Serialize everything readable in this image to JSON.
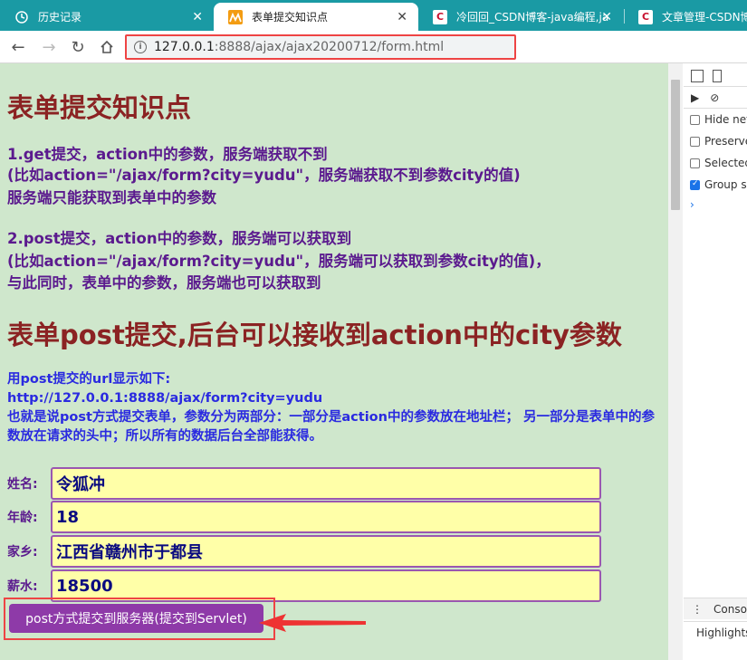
{
  "browser": {
    "tabs": [
      {
        "label": "历史记录",
        "favicon": "history-icon",
        "active": false
      },
      {
        "label": "表单提交知识点",
        "favicon": "ma-icon",
        "active": true
      },
      {
        "label": "冷回回_CSDN博客-java编程,ja",
        "favicon": "C",
        "active": false
      },
      {
        "label": "文章管理-CSDN博",
        "favicon": "C",
        "active": false
      }
    ],
    "url_host": "127.0.0.1",
    "url_rest": ":8888/ajax/ajax20200712/form.html"
  },
  "page": {
    "title": "表单提交知识点",
    "get_section": [
      "1.get提交，action中的参数，服务端获取不到",
      "(比如action=\"/ajax/form?city=yudu\"，服务端获取不到参数city的值)",
      "服务端只能获取到表单中的参数"
    ],
    "post_section": [
      "2.post提交，action中的参数，服务端可以获取到",
      "(比如action=\"/ajax/form?city=yudu\"，服务端可以获取到参数city的值)，",
      "与此同时，表单中的参数，服务端也可以获取到"
    ],
    "subtitle": "表单post提交,后台可以接收到action中的city参数",
    "notes": [
      "用post提交的url显示如下:",
      "http://127.0.0.1:8888/ajax/form?city=yudu",
      "也就是说post方式提交表单，参数分为两部分：一部分是action中的参数放在地址栏； 另一部分是表单中的参数放在请求的头中；所以所有的数据后台全部能获得。"
    ],
    "form": {
      "fields": [
        {
          "label": "姓名:",
          "value": "令狐冲"
        },
        {
          "label": "年龄:",
          "value": "18"
        },
        {
          "label": "家乡:",
          "value": "江西省赣州市于都县"
        },
        {
          "label": "薪水:",
          "value": "18500"
        }
      ],
      "submit_label": "post方式提交到服务器(提交到Servlet)"
    }
  },
  "devtools": {
    "options": [
      {
        "label": "Hide netw",
        "checked": false
      },
      {
        "label": "Preserve",
        "checked": false
      },
      {
        "label": "Selected",
        "checked": false
      },
      {
        "label": "Group sir",
        "checked": true
      }
    ],
    "console_tab": "Console",
    "highlights_label": "Highlights"
  }
}
